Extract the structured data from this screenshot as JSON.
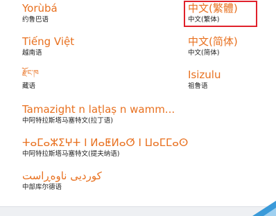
{
  "languages": [
    {
      "id": "yoruba",
      "native": "Yorùbá",
      "local": "约鲁巴语"
    },
    {
      "id": "zh-traditional",
      "native": "中文(繁體)",
      "local": "中文(繁体)",
      "selected": true
    },
    {
      "id": "vietnamese",
      "native": "Tiếng Việt",
      "local": "越南语"
    },
    {
      "id": "zh-simplified",
      "native": "中文(简体)",
      "local": "中文(简体)"
    },
    {
      "id": "tibetan",
      "native": "རྫོང་ཁ",
      "local": "藏语"
    },
    {
      "id": "zulu",
      "native": "Isizulu",
      "local": "祖鲁语"
    },
    {
      "id": "tamazight-latin",
      "native": "Tamazight n laṭlaṣ n wamm...",
      "local": "中阿特拉斯塔马塞特文(拉丁语)"
    },
    {
      "id": "tamazight-tifinagh",
      "native": "ⵜⴰⵎⴰⵣⵉⵖⵜ ⵏ ⵍⴰⵟⵍⴰⵚ ⵏ ⵡⴰⵎⵎⴰⵙ",
      "local": "中阿特拉斯塔马塞特文(提夫纳语)"
    },
    {
      "id": "kurdish-central",
      "native": "کوردیی ناوەڕاست",
      "local": "中部库尔德语"
    }
  ],
  "colors": {
    "accent": "#e8701f",
    "selection_border": "#e0202a",
    "corner_accent": "#3a9ad9"
  }
}
